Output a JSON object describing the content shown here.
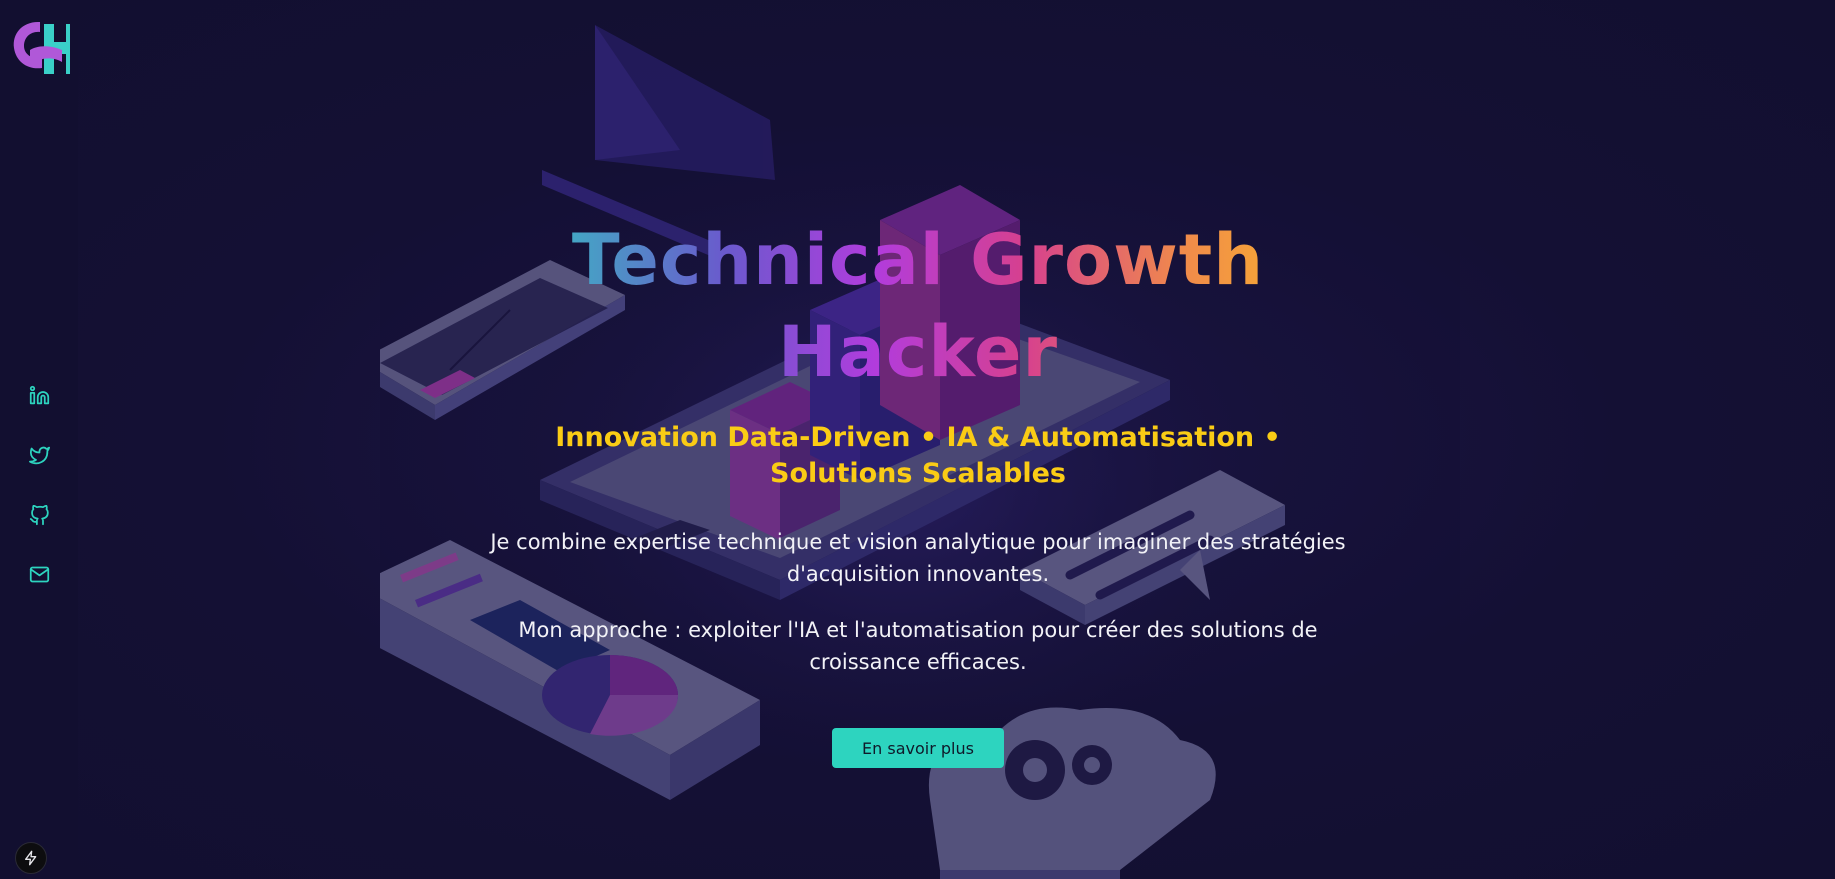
{
  "sidebar": {
    "logo": {
      "text": "GH",
      "alt": "GH logo"
    },
    "social_links": [
      {
        "name": "linkedin",
        "icon": "linkedin-icon"
      },
      {
        "name": "twitter",
        "icon": "twitter-icon"
      },
      {
        "name": "github",
        "icon": "github-icon"
      },
      {
        "name": "email",
        "icon": "mail-icon"
      }
    ],
    "badge_icon": "lightning-icon"
  },
  "hero": {
    "title": "Technical Growth Hacker",
    "subtitle": "Innovation Data-Driven • IA & Automatisation • Solutions Scalables",
    "paragraph_1": "Je combine expertise technique et vision analytique pour imaginer des stratégies d'acquisition innovantes.",
    "paragraph_2": "Mon approche : exploiter l'IA et l'automatisation pour créer des solutions de croissance efficaces.",
    "cta_label": "En savoir plus"
  },
  "colors": {
    "background": "#141034",
    "accent_teal": "#2dd4bf",
    "accent_yellow": "#facc15",
    "accent_purple": "#b13cdd",
    "accent_orange": "#f08a4b"
  },
  "background_illustration": "isometric-growth-hacking-illustration"
}
